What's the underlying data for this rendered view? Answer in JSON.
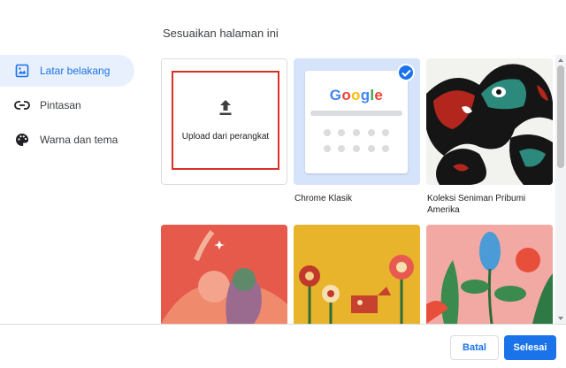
{
  "title": "Sesuaikan halaman ini",
  "sidebar": {
    "items": [
      {
        "label": "Latar belakang",
        "icon": "wallpaper-icon",
        "active": true
      },
      {
        "label": "Pintasan",
        "icon": "link-icon",
        "active": false
      },
      {
        "label": "Warna dan tema",
        "icon": "palette-icon",
        "active": false
      }
    ]
  },
  "tiles": {
    "upload_label": "Upload dari perangkat",
    "chrome_classic_caption": "Chrome Klasik",
    "chrome_classic_logo": "Google",
    "indigenous_caption": "Koleksi Seniman Pribumi Amerika"
  },
  "footer": {
    "cancel_label": "Batal",
    "done_label": "Selesai"
  },
  "colors": {
    "accent": "#1a73e8",
    "highlight_border": "#d93025",
    "active_bg": "#e8f0fe"
  }
}
